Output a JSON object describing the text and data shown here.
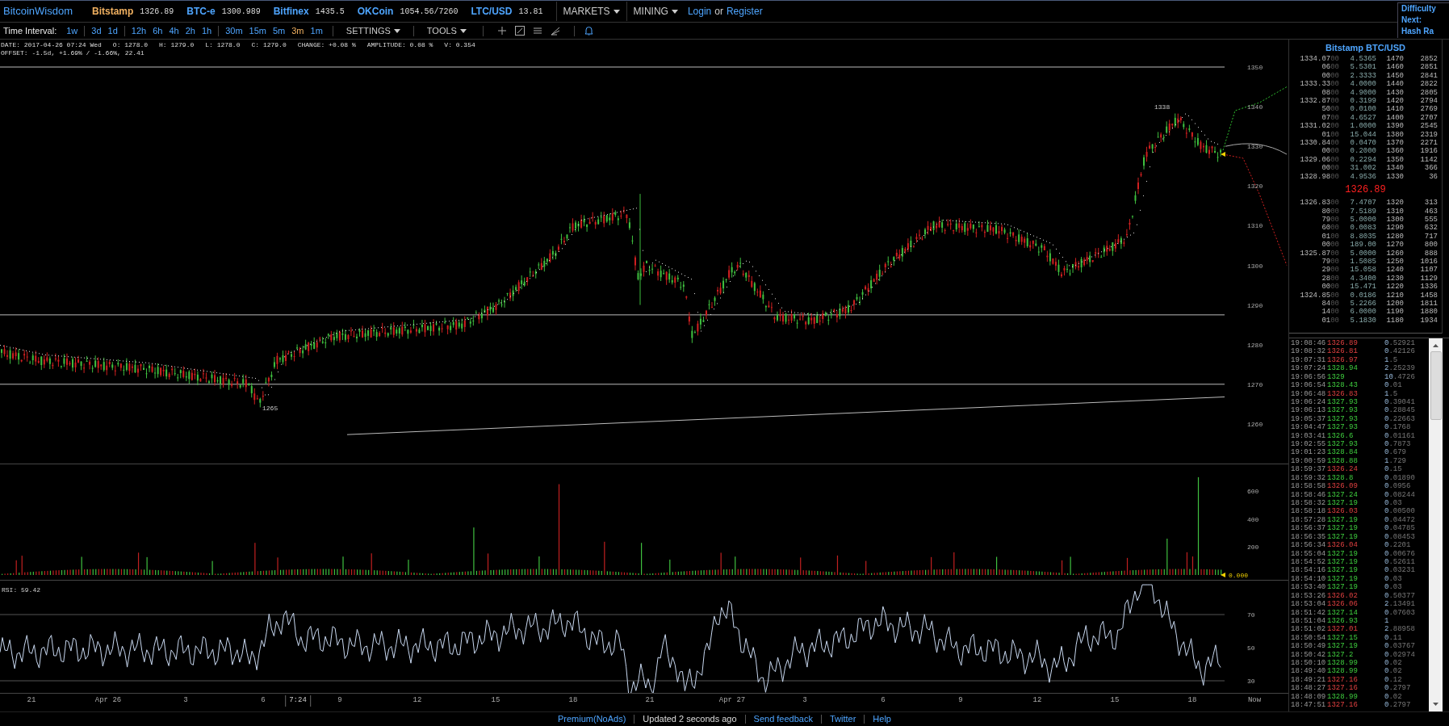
{
  "nav": {
    "logo": "BitcoinWisdom",
    "markets": [
      {
        "name": "Bitstamp",
        "price": "1326.89",
        "selected": true
      },
      {
        "name": "BTC-e",
        "price": "1300.989",
        "selected": false
      },
      {
        "name": "Bitfinex",
        "price": "1435.5",
        "selected": false
      },
      {
        "name": "OKCoin",
        "price": "1054.56/7260",
        "selected": false
      },
      {
        "name": "LTC/USD",
        "price": "13.81",
        "selected": false
      }
    ],
    "menus": [
      "MARKETS",
      "MINING"
    ],
    "login": "Login",
    "or": "or",
    "register": "Register",
    "side_info": [
      "Difficulty",
      "Next:",
      "Hash Ra"
    ]
  },
  "toolbar": {
    "label": "Time Interval:",
    "interval_groups": [
      [
        {
          "label": "1w",
          "selected": false
        }
      ],
      [
        {
          "label": "3d",
          "selected": false
        },
        {
          "label": "1d",
          "selected": false
        }
      ],
      [
        {
          "label": "12h",
          "selected": false
        },
        {
          "label": "6h",
          "selected": false
        },
        {
          "label": "4h",
          "selected": false
        },
        {
          "label": "2h",
          "selected": false
        },
        {
          "label": "1h",
          "selected": false
        }
      ],
      [
        {
          "label": "30m",
          "selected": false
        },
        {
          "label": "15m",
          "selected": false
        },
        {
          "label": "5m",
          "selected": false
        },
        {
          "label": "3m",
          "selected": true
        },
        {
          "label": "1m",
          "selected": false
        }
      ]
    ],
    "menus": [
      "SETTINGS",
      "TOOLS"
    ]
  },
  "info_line": [
    "DATE: 2017-04-26 07:24 Wed",
    "O: 1278.0",
    "H: 1279.0",
    "L: 1278.0",
    "C: 1279.0",
    "CHANGE: +0.08 %",
    "AMPLITUDE: 0.08 %",
    "V: 0.354"
  ],
  "offset_line": "OFFSET: -1.5d, +1.69% / -1.66%, 22.41",
  "price_chart": {
    "y_labels": [
      "1350",
      "1340",
      "1330",
      "1320",
      "1310",
      "1300",
      "1290",
      "1280",
      "1270",
      "1260"
    ],
    "high_label": "1338",
    "low_label": "1265"
  },
  "volume_chart": {
    "y_labels": [
      "600",
      "400",
      "200"
    ],
    "last_volume": "0.000"
  },
  "rsi_chart": {
    "title": "RSI: 59.42",
    "y_labels": [
      "70",
      "50",
      "30"
    ]
  },
  "x_axis": [
    {
      "label": "21",
      "selected": false
    },
    {
      "label": "Apr 26",
      "selected": false
    },
    {
      "label": "3",
      "selected": false
    },
    {
      "label": "6",
      "selected": false
    },
    {
      "label": "7:24",
      "selected": true
    },
    {
      "label": "9",
      "selected": false
    },
    {
      "label": "12",
      "selected": false
    },
    {
      "label": "15",
      "selected": false
    },
    {
      "label": "18",
      "selected": false
    },
    {
      "label": "21",
      "selected": false
    },
    {
      "label": "Apr 27",
      "selected": false
    },
    {
      "label": "3",
      "selected": false
    },
    {
      "label": "6",
      "selected": false
    },
    {
      "label": "9",
      "selected": false
    },
    {
      "label": "12",
      "selected": false
    },
    {
      "label": "15",
      "selected": false
    },
    {
      "label": "18",
      "selected": false
    },
    {
      "label": "Now",
      "selected": false
    }
  ],
  "order_book": {
    "title": "Bitstamp BTC/USD",
    "last_price": "1326.89",
    "asks": [
      [
        "1334.07",
        "00",
        "4.5365",
        "1470",
        "2852"
      ],
      [
        "06",
        "00",
        "5.5301",
        "1460",
        "2851"
      ],
      [
        "00",
        "00",
        "2.3333",
        "1450",
        "2841"
      ],
      [
        "1333.33",
        "00",
        "4.0000",
        "1440",
        "2822"
      ],
      [
        "08",
        "00",
        "4.9000",
        "1430",
        "2805"
      ],
      [
        "1332.87",
        "00",
        "0.3199",
        "1420",
        "2794"
      ],
      [
        "50",
        "00",
        "0.0100",
        "1410",
        "2769"
      ],
      [
        "07",
        "00",
        "4.6527",
        "1400",
        "2707"
      ],
      [
        "1331.02",
        "00",
        "1.0000",
        "1390",
        "2545"
      ],
      [
        "01",
        "00",
        "15.044",
        "1380",
        "2319"
      ],
      [
        "1330.84",
        "00",
        "0.0470",
        "1370",
        "2271"
      ],
      [
        "00",
        "00",
        "0.2000",
        "1360",
        "1916"
      ],
      [
        "1329.06",
        "00",
        "0.2294",
        "1350",
        "1142"
      ],
      [
        "00",
        "00",
        "31.002",
        "1340",
        "366"
      ],
      [
        "1328.98",
        "00",
        "4.9536",
        "1330",
        "36"
      ]
    ],
    "bids": [
      [
        "1326.83",
        "00",
        "7.4707",
        "1320",
        "313"
      ],
      [
        "80",
        "00",
        "7.5189",
        "1310",
        "463"
      ],
      [
        "79",
        "00",
        "5.0000",
        "1300",
        "555"
      ],
      [
        "60",
        "00",
        "0.0083",
        "1290",
        "632"
      ],
      [
        "01",
        "00",
        "8.8035",
        "1280",
        "717"
      ],
      [
        "00",
        "00",
        "189.00",
        "1270",
        "800"
      ],
      [
        "1325.87",
        "00",
        "5.0000",
        "1260",
        "888"
      ],
      [
        "79",
        "00",
        "1.5085",
        "1250",
        "1016"
      ],
      [
        "29",
        "00",
        "15.058",
        "1240",
        "1107"
      ],
      [
        "28",
        "00",
        "4.3400",
        "1230",
        "1129"
      ],
      [
        "00",
        "00",
        "15.471",
        "1220",
        "1336"
      ],
      [
        "1324.85",
        "00",
        "0.0186",
        "1210",
        "1458"
      ],
      [
        "84",
        "00",
        "5.2266",
        "1200",
        "1811"
      ],
      [
        "14",
        "00",
        "6.0000",
        "1190",
        "1880"
      ],
      [
        "01",
        "00",
        "5.1830",
        "1180",
        "1934"
      ]
    ]
  },
  "trades": [
    {
      "time": "19:08:46",
      "price": "1326.89",
      "kind": "sell",
      "amount": "0.52921"
    },
    {
      "time": "19:08:32",
      "price": "1326.81",
      "kind": "sell",
      "amount": "0.42126"
    },
    {
      "time": "19:07:31",
      "price": "1326.97",
      "kind": "sell",
      "amount": "1.5"
    },
    {
      "time": "19:07:24",
      "price": "1328.94",
      "kind": "buy",
      "amount": "2.25239"
    },
    {
      "time": "19:06:56",
      "price": "1329",
      "kind": "buy",
      "amount": "10.4726"
    },
    {
      "time": "19:06:54",
      "price": "1328.43",
      "kind": "buy",
      "amount": "0.01"
    },
    {
      "time": "19:06:48",
      "price": "1326.83",
      "kind": "sell",
      "amount": "1.5"
    },
    {
      "time": "19:06:24",
      "price": "1327.93",
      "kind": "buy",
      "amount": "0.39041"
    },
    {
      "time": "19:06:13",
      "price": "1327.93",
      "kind": "buy",
      "amount": "0.28845"
    },
    {
      "time": "19:05:37",
      "price": "1327.93",
      "kind": "buy",
      "amount": "0.22663"
    },
    {
      "time": "19:04:47",
      "price": "1327.93",
      "kind": "buy",
      "amount": "0.1768"
    },
    {
      "time": "19:03:41",
      "price": "1326.6",
      "kind": "buy",
      "amount": "0.01161"
    },
    {
      "time": "19:02:55",
      "price": "1327.93",
      "kind": "buy",
      "amount": "0.7873"
    },
    {
      "time": "19:01:23",
      "price": "1328.84",
      "kind": "buy",
      "amount": "0.679"
    },
    {
      "time": "19:00:59",
      "price": "1328.88",
      "kind": "buy",
      "amount": "1.729"
    },
    {
      "time": "18:59:37",
      "price": "1326.24",
      "kind": "sell",
      "amount": "0.15"
    },
    {
      "time": "18:59:32",
      "price": "1328.8",
      "kind": "buy",
      "amount": "0.01890"
    },
    {
      "time": "18:58:58",
      "price": "1326.09",
      "kind": "sell",
      "amount": "0.0956"
    },
    {
      "time": "18:58:46",
      "price": "1327.24",
      "kind": "buy",
      "amount": "0.08244"
    },
    {
      "time": "18:58:32",
      "price": "1327.19",
      "kind": "buy",
      "amount": "0.03"
    },
    {
      "time": "18:58:18",
      "price": "1326.03",
      "kind": "sell",
      "amount": "0.00500"
    },
    {
      "time": "18:57:28",
      "price": "1327.19",
      "kind": "buy",
      "amount": "0.04472"
    },
    {
      "time": "18:56:37",
      "price": "1327.19",
      "kind": "buy",
      "amount": "0.04785"
    },
    {
      "time": "18:56:35",
      "price": "1327.19",
      "kind": "buy",
      "amount": "0.08453"
    },
    {
      "time": "18:56:34",
      "price": "1326.04",
      "kind": "sell",
      "amount": "0.2201"
    },
    {
      "time": "18:55:04",
      "price": "1327.19",
      "kind": "buy",
      "amount": "0.00676"
    },
    {
      "time": "18:54:52",
      "price": "1327.19",
      "kind": "buy",
      "amount": "0.52611"
    },
    {
      "time": "18:54:16",
      "price": "1327.19",
      "kind": "buy",
      "amount": "0.03231"
    },
    {
      "time": "18:54:10",
      "price": "1327.19",
      "kind": "buy",
      "amount": "0.03"
    },
    {
      "time": "18:53:40",
      "price": "1327.19",
      "kind": "buy",
      "amount": "0.03"
    },
    {
      "time": "18:53:26",
      "price": "1326.02",
      "kind": "sell",
      "amount": "0.50377"
    },
    {
      "time": "18:53:04",
      "price": "1326.06",
      "kind": "sell",
      "amount": "2.13491"
    },
    {
      "time": "18:51:42",
      "price": "1327.14",
      "kind": "buy",
      "amount": "0.07603"
    },
    {
      "time": "18:51:04",
      "price": "1326.93",
      "kind": "buy",
      "amount": "1"
    },
    {
      "time": "18:51:02",
      "price": "1327.01",
      "kind": "sell",
      "amount": "2.88958"
    },
    {
      "time": "18:50:54",
      "price": "1327.15",
      "kind": "buy",
      "amount": "0.11"
    },
    {
      "time": "18:50:49",
      "price": "1327.19",
      "kind": "buy",
      "amount": "0.03767"
    },
    {
      "time": "18:50:42",
      "price": "1327.2",
      "kind": "buy",
      "amount": "0.02974"
    },
    {
      "time": "18:50:10",
      "price": "1328.99",
      "kind": "buy",
      "amount": "0.02"
    },
    {
      "time": "18:49:40",
      "price": "1328.99",
      "kind": "buy",
      "amount": "0.02"
    },
    {
      "time": "18:49:21",
      "price": "1327.16",
      "kind": "sell",
      "amount": "0.12"
    },
    {
      "time": "18:48:27",
      "price": "1327.16",
      "kind": "sell",
      "amount": "0.2797"
    },
    {
      "time": "18:48:09",
      "price": "1328.99",
      "kind": "buy",
      "amount": "0.02"
    },
    {
      "time": "18:47:51",
      "price": "1327.16",
      "kind": "sell",
      "amount": "0.2797"
    }
  ],
  "footer": {
    "links": [
      "Premium(NoAds)",
      "Updated 2 seconds ago",
      "Send feedback",
      "Twitter",
      "Help"
    ]
  }
}
